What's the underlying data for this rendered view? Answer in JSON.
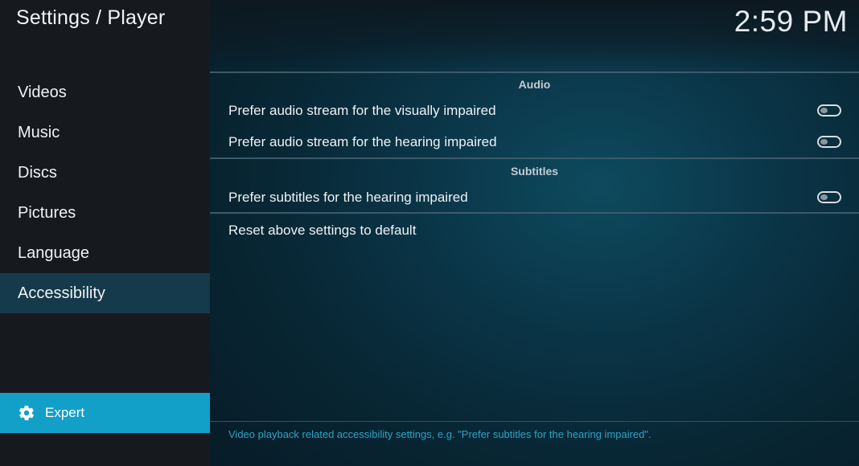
{
  "header": {
    "title": "Settings / Player",
    "clock": "2:59 PM"
  },
  "sidebar": {
    "items": [
      {
        "label": "Videos",
        "active": false
      },
      {
        "label": "Music",
        "active": false
      },
      {
        "label": "Discs",
        "active": false
      },
      {
        "label": "Pictures",
        "active": false
      },
      {
        "label": "Language",
        "active": false
      },
      {
        "label": "Accessibility",
        "active": true
      }
    ],
    "expert": {
      "label": "Expert",
      "icon": "gear-icon"
    }
  },
  "settings": {
    "audio": {
      "header": "Audio",
      "rows": [
        {
          "label": "Prefer audio stream for the visually impaired",
          "value": false
        },
        {
          "label": "Prefer audio stream for the hearing impaired",
          "value": false
        }
      ]
    },
    "subtitles": {
      "header": "Subtitles",
      "rows": [
        {
          "label": "Prefer subtitles for the hearing impaired",
          "value": false
        }
      ]
    },
    "reset_label": "Reset above settings to default"
  },
  "footer": {
    "description": "Video playback related accessibility settings, e.g. \"Prefer subtitles for the hearing impaired\"."
  },
  "colors": {
    "accent": "#12a0c8",
    "active_item": "#153a4b",
    "footer_text": "#2ba3c7"
  }
}
